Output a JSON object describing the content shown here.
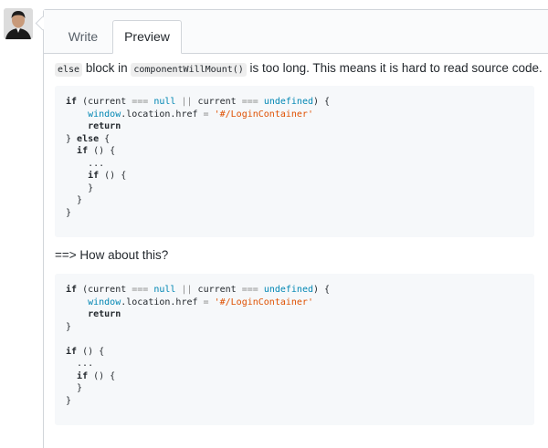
{
  "tabs": [
    {
      "label": "Write",
      "active": false
    },
    {
      "label": "Preview",
      "active": true
    }
  ],
  "preview": {
    "p1": {
      "code1": "else",
      "text1": " block in ",
      "code2": "componentWillMount()",
      "text2": " is too long. This means it is hard to read source code."
    },
    "block1": [
      [
        "kw:if",
        "t: (current ",
        "op:===",
        "t: ",
        "id:null",
        "t: ",
        "op:||",
        "t: current ",
        "op:===",
        "t: ",
        "id:undefined",
        "t:) {"
      ],
      [
        "t:    ",
        "id:window",
        "t:.location.href ",
        "op:=",
        "t: ",
        "str:'#/LoginContainer'"
      ],
      [
        "t:    ",
        "kw:return"
      ],
      [
        "t:} ",
        "kw:else",
        "t: {"
      ],
      [
        "t:  ",
        "kw:if",
        "t: () {"
      ],
      [
        "t:    ..."
      ],
      [
        "t:    ",
        "kw:if",
        "t: () {"
      ],
      [
        "t:    }"
      ],
      [
        "t:  }"
      ],
      [
        "t:}"
      ]
    ],
    "p2": "==> How about this?",
    "block2": [
      [
        "kw:if",
        "t: (current ",
        "op:===",
        "t: ",
        "id:null",
        "t: ",
        "op:||",
        "t: current ",
        "op:===",
        "t: ",
        "id:undefined",
        "t:) {"
      ],
      [
        "t:    ",
        "id:window",
        "t:.location.href ",
        "op:=",
        "t: ",
        "str:'#/LoginContainer'"
      ],
      [
        "t:    ",
        "kw:return"
      ],
      [
        "t:}"
      ],
      [],
      [
        "kw:if",
        "t: () {"
      ],
      [
        "t:  ..."
      ],
      [
        "t:  ",
        "kw:if",
        "t: () {"
      ],
      [
        "t:  }"
      ],
      [
        "t:}"
      ]
    ]
  }
}
